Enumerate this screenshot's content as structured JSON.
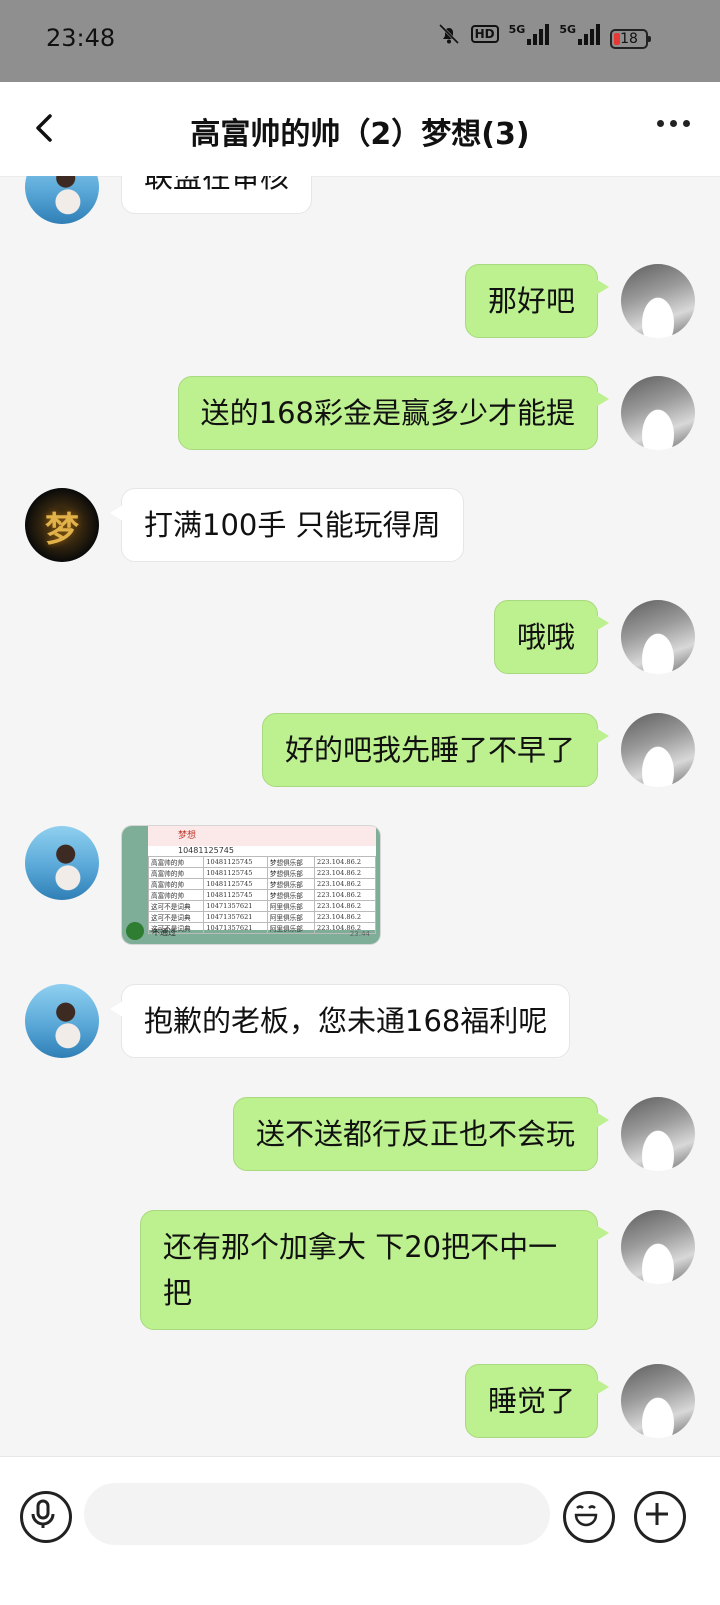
{
  "status_bar": {
    "time": "23:48",
    "network_1": "5G",
    "network_2": "5G",
    "hd_label": "HD",
    "battery_level": "18",
    "icons": [
      "bell-muted-icon",
      "hd-icon",
      "signal-icon",
      "signal-icon",
      "battery-icon"
    ]
  },
  "header": {
    "title": "高富帅的帅（2）梦想(3)",
    "back_icon": "chevron-left-icon",
    "more_icon": "more-dots-icon"
  },
  "messages": [
    {
      "side": "in",
      "avatar": "sea-girl",
      "text": "联盟在审核"
    },
    {
      "side": "out",
      "avatar": "me",
      "text": "那好吧"
    },
    {
      "side": "out",
      "avatar": "me",
      "text": "送的168彩金是赢多少才能提"
    },
    {
      "side": "in",
      "avatar": "mengxiang-logo",
      "text": "打满100手 只能玩得周"
    },
    {
      "side": "out",
      "avatar": "me",
      "text": "哦哦"
    },
    {
      "side": "out",
      "avatar": "me",
      "text": "好的吧我先睡了不早了"
    },
    {
      "side": "in",
      "avatar": "sea-girl",
      "type": "image",
      "image": {
        "header": "梦想",
        "id": "10481125745",
        "rows": [
          [
            "高富帅的帅",
            "10481125745",
            "梦想俱乐部",
            "223.104.86.2"
          ],
          [
            "高富帅的帅",
            "10481125745",
            "梦想俱乐部",
            "223.104.86.2"
          ],
          [
            "高富帅的帅",
            "10481125745",
            "梦想俱乐部",
            "223.104.86.2"
          ],
          [
            "高富帅的帅",
            "10481125745",
            "梦想俱乐部",
            "223.104.86.2"
          ],
          [
            "这可不是词典",
            "10471357621",
            "阿里俱乐部",
            "223.104.86.2"
          ],
          [
            "这可不是词典",
            "10471357621",
            "阿里俱乐部",
            "223.104.86.2"
          ],
          [
            "这可不是词典",
            "10471357621",
            "阿里俱乐部",
            "223.104.86.2"
          ]
        ],
        "footer": "不通过",
        "time": "23:44"
      }
    },
    {
      "side": "in",
      "avatar": "sea-girl",
      "text": "抱歉的老板，您未通168福利呢"
    },
    {
      "side": "out",
      "avatar": "me",
      "text": "送不送都行反正也不会玩"
    },
    {
      "side": "out",
      "avatar": "me",
      "text": "还有那个加拿大 下20把不中一把"
    },
    {
      "side": "out",
      "avatar": "me",
      "text": "睡觉了"
    }
  ],
  "input_bar": {
    "voice_icon": "microphone-icon",
    "emoji_icon": "emoji-icon",
    "plus_icon": "plus-icon",
    "placeholder": ""
  }
}
